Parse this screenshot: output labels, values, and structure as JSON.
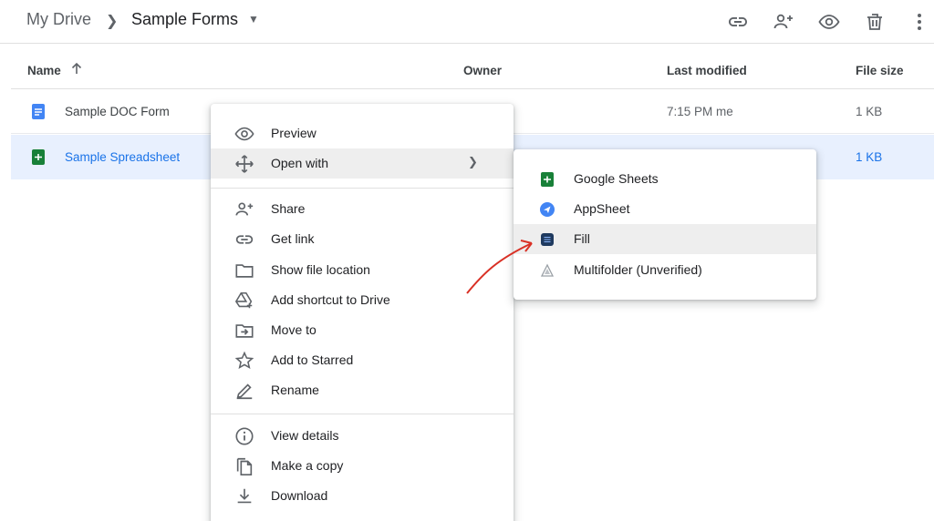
{
  "breadcrumb": {
    "root": "My Drive",
    "current": "Sample Forms"
  },
  "header_actions": [
    "link-icon",
    "add-person-icon",
    "eye-icon",
    "trash-icon",
    "more-vert-icon"
  ],
  "table": {
    "columns": {
      "name": "Name",
      "owner": "Owner",
      "last_modified": "Last modified",
      "file_size": "File size"
    },
    "rows": [
      {
        "name": "Sample DOC Form",
        "type": "doc",
        "owner": "",
        "last_modified": "7:15 PM",
        "modified_by": "me",
        "file_size": "1 KB"
      },
      {
        "name": "Sample Spreadsheet",
        "type": "sheet",
        "owner": "",
        "last_modified": "",
        "modified_by": "",
        "file_size": "1 KB",
        "selected": true
      }
    ]
  },
  "context_menu": {
    "items": [
      {
        "label": "Preview",
        "icon": "eye-icon"
      },
      {
        "label": "Open with",
        "icon": "move-icon",
        "submenu": true,
        "highlighted": true
      },
      {
        "label": "Share",
        "icon": "add-person-icon"
      },
      {
        "label": "Get link",
        "icon": "link-icon"
      },
      {
        "label": "Show file location",
        "icon": "folder-icon"
      },
      {
        "label": "Add shortcut to Drive",
        "icon": "drive-shortcut-icon"
      },
      {
        "label": "Move to",
        "icon": "move-to-folder-icon"
      },
      {
        "label": "Add to Starred",
        "icon": "star-icon"
      },
      {
        "label": "Rename",
        "icon": "pencil-icon"
      },
      {
        "label": "View details",
        "icon": "info-icon"
      },
      {
        "label": "Make a copy",
        "icon": "copy-icon"
      },
      {
        "label": "Download",
        "icon": "download-icon"
      }
    ]
  },
  "open_with_menu": {
    "items": [
      {
        "label": "Google Sheets",
        "icon": "google-sheets-icon"
      },
      {
        "label": "AppSheet",
        "icon": "appsheet-icon"
      },
      {
        "label": "Fill",
        "icon": "fill-app-icon",
        "highlighted": true
      },
      {
        "label": "Multifolder (Unverified)",
        "icon": "multifolder-icon"
      }
    ]
  },
  "colors": {
    "accent": "#1a73e8",
    "selected_row": "#e8f0fe",
    "sheets_green": "#188038",
    "docs_blue": "#4285f4",
    "annotation_red": "#d93025"
  }
}
